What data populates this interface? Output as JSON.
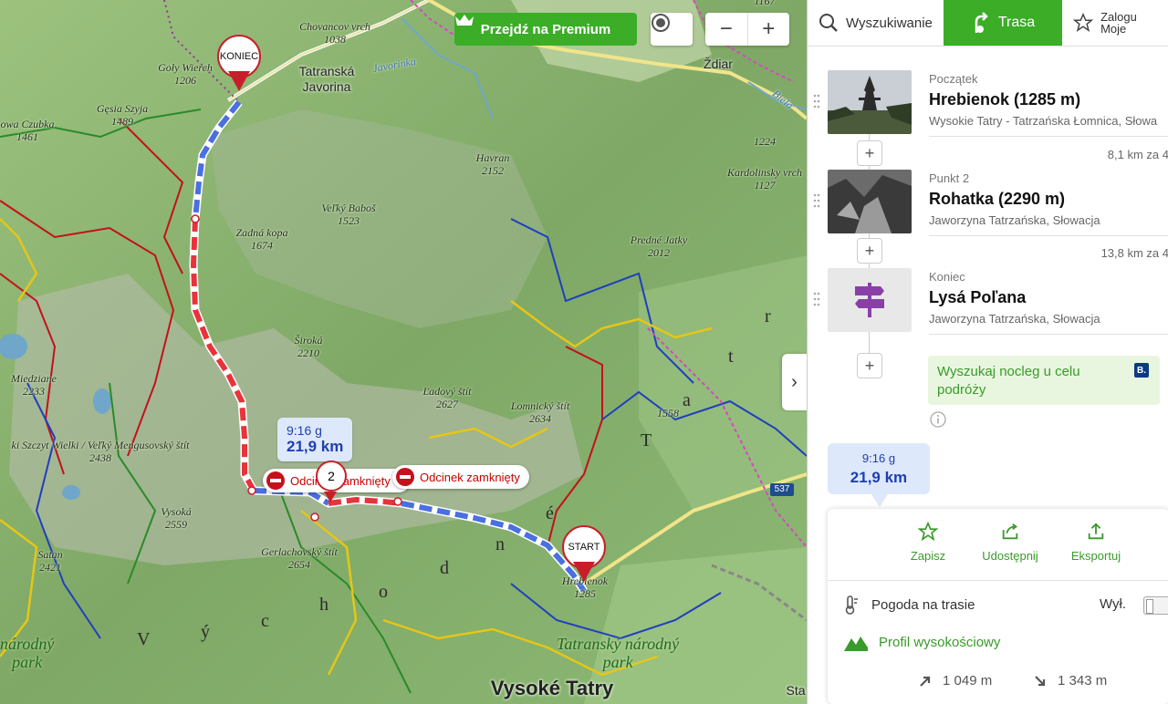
{
  "map": {
    "premium_label": "Przejdź na Premium",
    "zoom_out": "−",
    "zoom_in": "+",
    "collapse": "›",
    "peaks": [
      {
        "name": "Chovancov vrch",
        "ele": "1038"
      },
      {
        "name": "Goły Wierch",
        "ele": "1206"
      },
      {
        "name": "Gęsia Szyja",
        "ele": "1489"
      },
      {
        "name": "owa Czubka",
        "ele": "1461"
      },
      {
        "name": "Havran",
        "ele": "2152"
      },
      {
        "name": "Veľký Baboš",
        "ele": "1523"
      },
      {
        "name": "Zadná kopa",
        "ele": "1674"
      },
      {
        "name": "Predné Jatky",
        "ele": "2012"
      },
      {
        "name": "Kardolinsky vrch",
        "ele": "1127"
      },
      {
        "name": "",
        "ele": "1224"
      },
      {
        "name": "Široká",
        "ele": "2210"
      },
      {
        "name": "Miedziane",
        "ele": "2233"
      },
      {
        "name": "Ľadový štít",
        "ele": "2627"
      },
      {
        "name": "Lomnický štít",
        "ele": "2634"
      },
      {
        "name": "",
        "ele": "1558"
      },
      {
        "name": "ki Szczyt Wielki / Veľký Mengusovský štít",
        "ele": "2438"
      },
      {
        "name": "Vysoká",
        "ele": "2559"
      },
      {
        "name": "Satan",
        "ele": "2421"
      },
      {
        "name": "Gerlachovský štít",
        "ele": "2654"
      },
      {
        "name": "Hrebienok",
        "ele": "1285"
      },
      {
        "name": "",
        "ele": "1167"
      }
    ],
    "places": {
      "javorina": "Tatranská\nJavorina",
      "zdiar": "Ždiar",
      "vysoke_tatry": "Vysoké Tatry",
      "park_right": "Tatranský národný\npark",
      "park_left": "národný\npark",
      "sta": "Sta",
      "river1": "Javorinka",
      "river2": "Biela"
    },
    "region_letters": [
      "V",
      "ý",
      "c",
      "h",
      "o",
      "d",
      "n",
      "é",
      "T",
      "a",
      "t",
      "r"
    ],
    "road_label": "537",
    "pins": {
      "end": "KONIEC",
      "start": "START",
      "waypoint": "2"
    },
    "closed_label": "Odcinek zamknięty",
    "closed_label_short": "Odcin",
    "route_bubble": {
      "time": "9:16 g",
      "dist": "21,9 km"
    }
  },
  "panel": {
    "tabs": [
      {
        "label": "Wyszukiwanie",
        "icon": "search-icon"
      },
      {
        "label": "Trasa",
        "icon": "route-icon",
        "active": true
      },
      {
        "label": "Zalogu\nMoje",
        "icon": "star-icon"
      }
    ],
    "waypoints": [
      {
        "label": "Początek",
        "name": "Hrebienok (1285 m)",
        "sub": "Wysokie Tatry - Tatrzańska Łomnica, Słowa"
      },
      {
        "label": "Punkt 2",
        "name": "Rohatka (2290 m)",
        "sub": "Jaworzyna Tatrzańska, Słowacja"
      },
      {
        "label": "Koniec",
        "name": "Lysá Poľana",
        "sub": "Jaworzyna Tatrzańska, Słowacja"
      }
    ],
    "segments": [
      "8,1 km za 4",
      "13,8 km za 4"
    ],
    "booking": {
      "text": "Wyszukaj nocleg u celu podróży",
      "badge": "B."
    },
    "summary": {
      "time": "9:16 g",
      "dist": "21,9 km"
    },
    "actions": [
      {
        "label": "Zapisz",
        "icon": "star-icon"
      },
      {
        "label": "Udostępnij",
        "icon": "share-icon"
      },
      {
        "label": "Eksportuj",
        "icon": "export-icon"
      }
    ],
    "weather": {
      "label": "Pogoda na trasie",
      "toggle": "Wył."
    },
    "profile": {
      "label": "Profil wysokościowy"
    },
    "elevation": {
      "up": "1 049 m",
      "down": "1 343 m"
    },
    "colors": {
      "accent": "#3bad27",
      "route_red": "#e8333c",
      "route_blue": "#4a6fe0"
    }
  }
}
